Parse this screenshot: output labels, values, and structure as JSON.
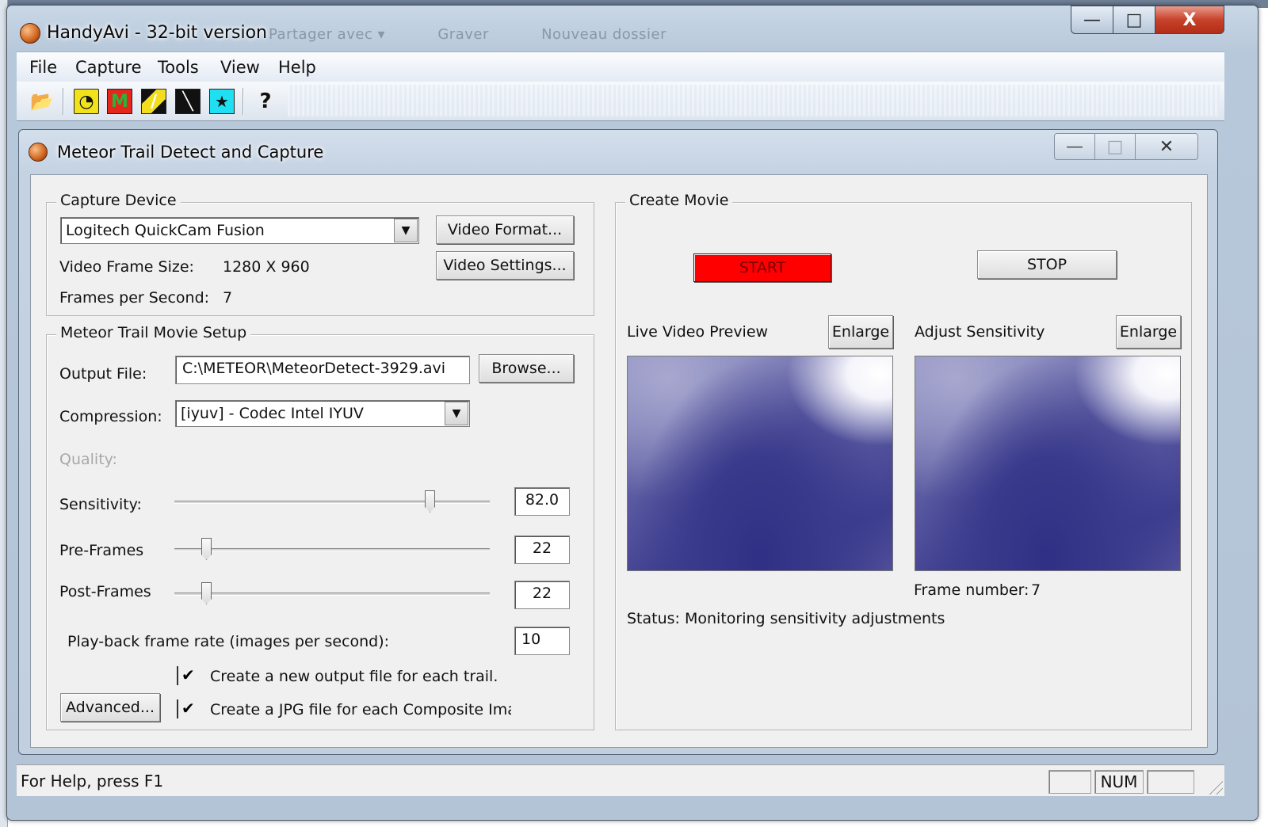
{
  "window": {
    "title": "HandyAvi - 32-bit version",
    "background_menu": [
      "Partager avec ▾",
      "Graver",
      "Nouveau dossier"
    ],
    "minimize_glyph": "—",
    "maximize_glyph": "□",
    "close_glyph": "X"
  },
  "menu": [
    "File",
    "Capture",
    "Tools",
    "View",
    "Help"
  ],
  "toolbar": {
    "icons": [
      "open-folder-icon",
      "clock-icon",
      "meteor-m-icon",
      "satellite-icon",
      "meteor-trail-icon",
      "figure-icon",
      "help-icon"
    ],
    "open_glyph": "📂",
    "clock_glyph": "◔",
    "m_glyph": "M",
    "satellite_glyph": "∕",
    "trail_glyph": "╲",
    "figure_glyph": "★",
    "help_glyph": "?"
  },
  "child_window": {
    "title": "Meteor Trail Detect and Capture",
    "minimize_glyph": "—",
    "maximize_glyph": "□",
    "close_glyph": "✕"
  },
  "capture_device": {
    "label": "Capture Device",
    "device": "Logitech QuickCam Fusion",
    "video_format_button": "Video Format...",
    "video_settings_button": "Video Settings...",
    "frame_size_label": "Video Frame Size:",
    "frame_size_value": "1280 X 960",
    "fps_label": "Frames per Second:",
    "fps_value": "7"
  },
  "movie_setup": {
    "label": "Meteor Trail Movie Setup",
    "output_label": "Output File:",
    "output_value": "C:\\METEOR\\MeteorDetect-3929.avi",
    "browse_button": "Browse...",
    "compression_label": "Compression:",
    "compression_value": "[iyuv] - Codec Intel IYUV",
    "quality_label": "Quality:",
    "sensitivity_label": "Sensitivity:",
    "sensitivity_value": "82.0",
    "sensitivity_level": 0.82,
    "preframes_label": "Pre-Frames",
    "preframes_value": "22",
    "postframes_label": "Post-Frames",
    "postframes_value": "22",
    "playback_label": "Play-back frame rate (images per second):",
    "playback_value": "10",
    "checkbox_new_file": "Create a new output file for each trail.",
    "checkbox_jpg": "Create a JPG file for each Composite Imag",
    "check_glyph": "✔",
    "advanced_button": "Advanced..."
  },
  "create_movie": {
    "label": "Create Movie",
    "start_button": "START",
    "stop_button": "STOP",
    "live_preview_label": "Live Video Preview",
    "adjust_label": "Adjust Sensitivity",
    "enlarge_button": "Enlarge",
    "frame_number_label": "Frame number:",
    "frame_number_value": "7",
    "status_label": "Status:",
    "status_value": "Monitoring sensitivity adjustments",
    "start_color": "#ff0000"
  },
  "statusbar": {
    "help_text": "For Help, press F1",
    "num": "NUM"
  }
}
